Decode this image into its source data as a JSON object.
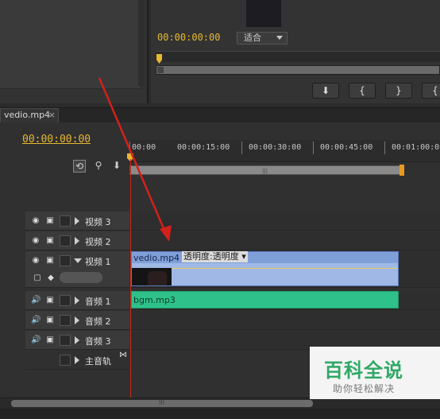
{
  "program_monitor": {
    "timecode": "00:00:00:00",
    "fit_label": "适合",
    "transport_buttons": [
      "⬇",
      "{",
      "}",
      "{"
    ]
  },
  "timeline": {
    "tab_label": "vedio.mp4",
    "tab_close": "×",
    "timecode": "00:00:00:00",
    "ruler_labels": [
      "00:00",
      "00:00:15:00",
      "00:00:30:00",
      "00:00:45:00",
      "00:01:00:00"
    ],
    "tracks": {
      "video3": "视频 3",
      "video2": "视频 2",
      "video1": "视频 1",
      "audio1": "音频 1",
      "audio2": "音频 2",
      "audio3": "音频 3",
      "master": "主音轨"
    },
    "video_clip_name": "vedio.mp4",
    "opacity_label": "透明度:透明度",
    "audio_clip_name": "bgm.mp3"
  },
  "watermark": {
    "title": "百科全说",
    "subtitle": "助你轻松解决"
  },
  "colors": {
    "timecode": "#e8b830",
    "playhead": "#cc2a1a",
    "video_clip": "#9fb8e6",
    "audio_clip": "#2ec28a",
    "watermark_green": "#2fa866",
    "annotation_arrow": "#d4201a"
  }
}
